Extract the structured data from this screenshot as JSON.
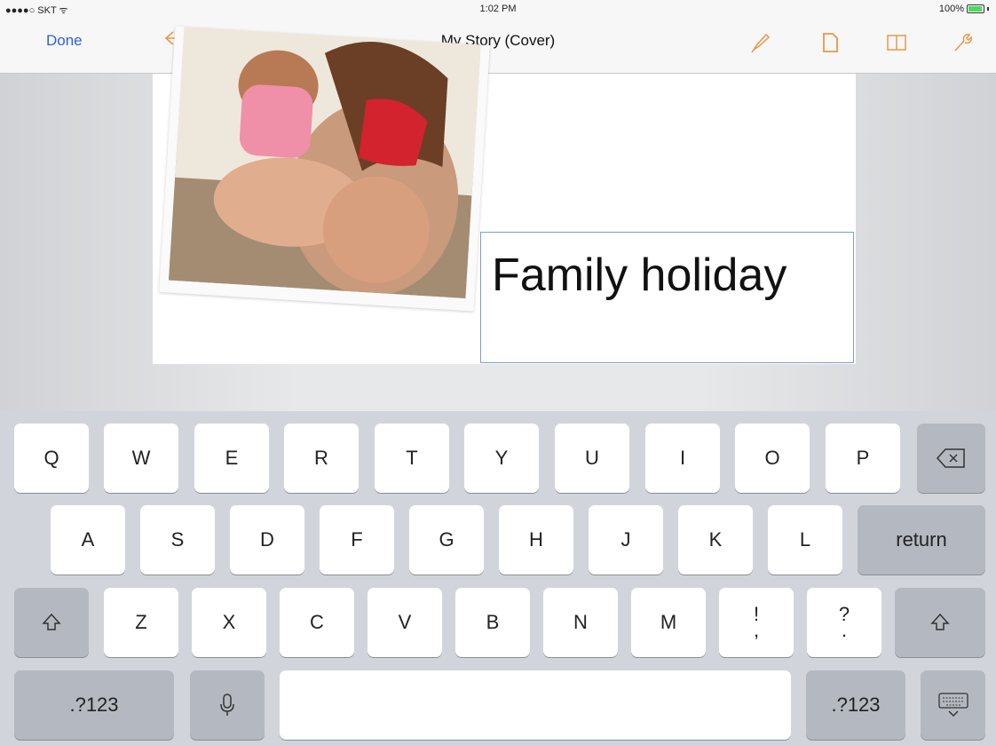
{
  "status": {
    "carrier": "●●●●○ SKT ᯤ",
    "time": "1:02 PM",
    "battery": "100%"
  },
  "nav": {
    "done": "Done",
    "title": "My Story (Cover)"
  },
  "document": {
    "title_text": "Family holiday"
  },
  "keyboard": {
    "row1": [
      "Q",
      "W",
      "E",
      "R",
      "T",
      "Y",
      "U",
      "I",
      "O",
      "P"
    ],
    "row2": [
      "A",
      "S",
      "D",
      "F",
      "G",
      "H",
      "J",
      "K",
      "L"
    ],
    "return": "return",
    "row3": [
      "Z",
      "X",
      "C",
      "V",
      "B",
      "N",
      "M"
    ],
    "excl_top": "!",
    "excl_bottom": ",",
    "quest_top": "?",
    "quest_bottom": ".",
    "numbers_left": ".?123",
    "numbers_right": ".?123"
  }
}
